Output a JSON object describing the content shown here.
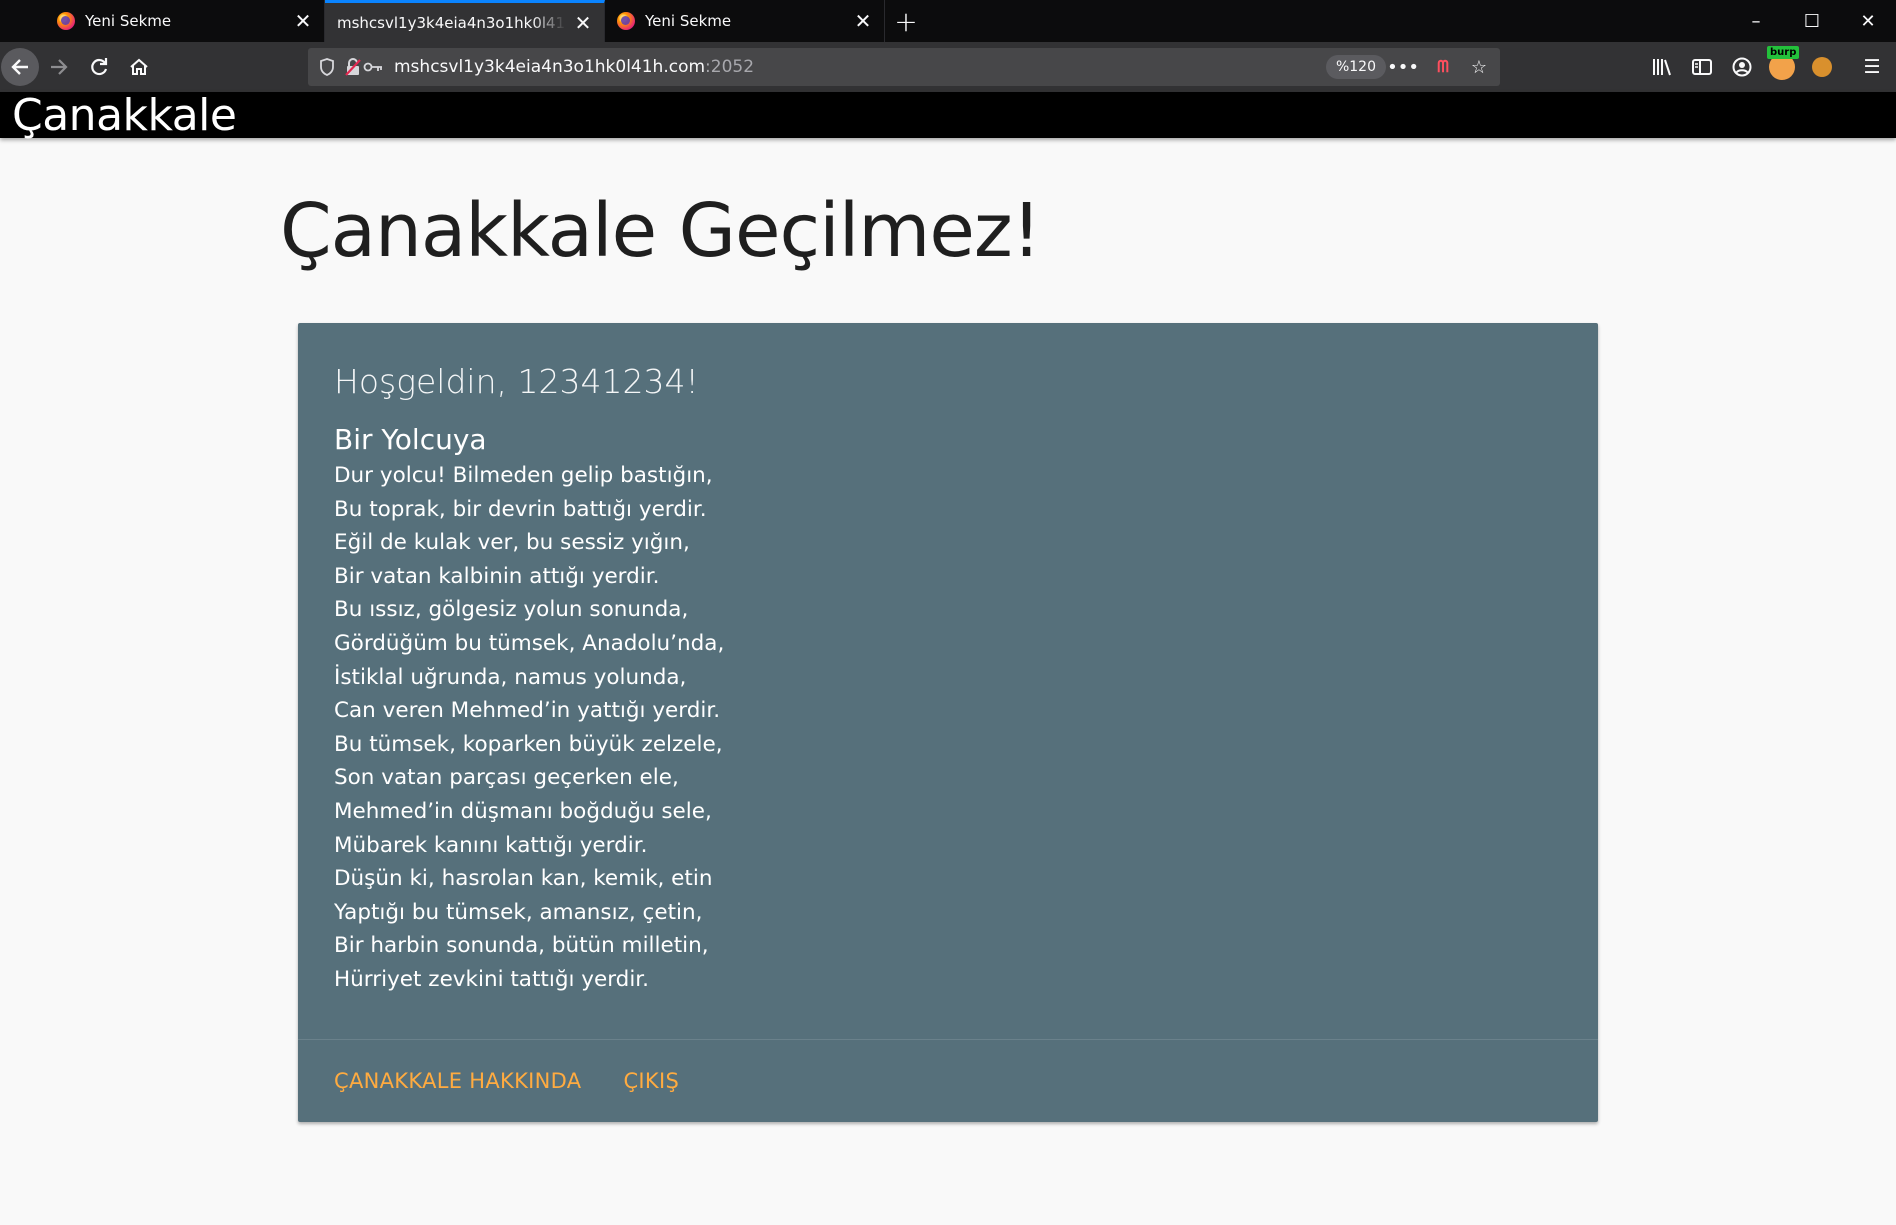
{
  "browser": {
    "tabs": [
      {
        "title": "Yeni Sekme",
        "active": false
      },
      {
        "title": "mshcsvl1y3k4eia4n3o1hk0l41h.com",
        "active": true
      },
      {
        "title": "Yeni Sekme",
        "active": false
      }
    ],
    "url_host": "mshcsvl1y3k4eia4n3o1hk0l41h.com",
    "url_port": ":2052",
    "zoom": "%120",
    "burp_badge": "burp"
  },
  "site": {
    "brand": "Çanakkale",
    "title": "Çanakkale Geçilmez!",
    "welcome": "Hoşgeldin, 12341234!",
    "poem_title": "Bir Yolcuya",
    "poem_lines": [
      "Dur yolcu! Bilmeden gelip bastığın,",
      "Bu toprak, bir devrin battığı yerdir.",
      "Eğil de kulak ver, bu sessiz yığın,",
      "Bir vatan kalbinin attığı yerdir.",
      "Bu ıssız, gölgesiz yolun sonunda,",
      "Gördüğüm bu tümsek, Anadolu’nda,",
      "İstiklal uğrunda, namus yolunda,",
      "Can veren Mehmed’in yattığı yerdir.",
      "Bu tümsek, koparken büyük zelzele,",
      "Son vatan parçası geçerken ele,",
      "Mehmed’in düşmanı boğduğu sele,",
      "Mübarek kanını kattığı yerdir.",
      "Düşün ki, hasrolan kan, kemik, etin",
      "Yaptığı bu tümsek, amansız, çetin,",
      "Bir harbin sonunda, bütün milletin,",
      "Hürriyet zevkini tattığı yerdir."
    ],
    "links": {
      "about": "ÇANAKKALE HAKKINDA",
      "logout": "ÇIKIŞ"
    }
  },
  "colors": {
    "card_bg": "#56707b",
    "link": "#ffab40",
    "header_bg": "#000000",
    "tab_accent": "#0a84ff"
  }
}
